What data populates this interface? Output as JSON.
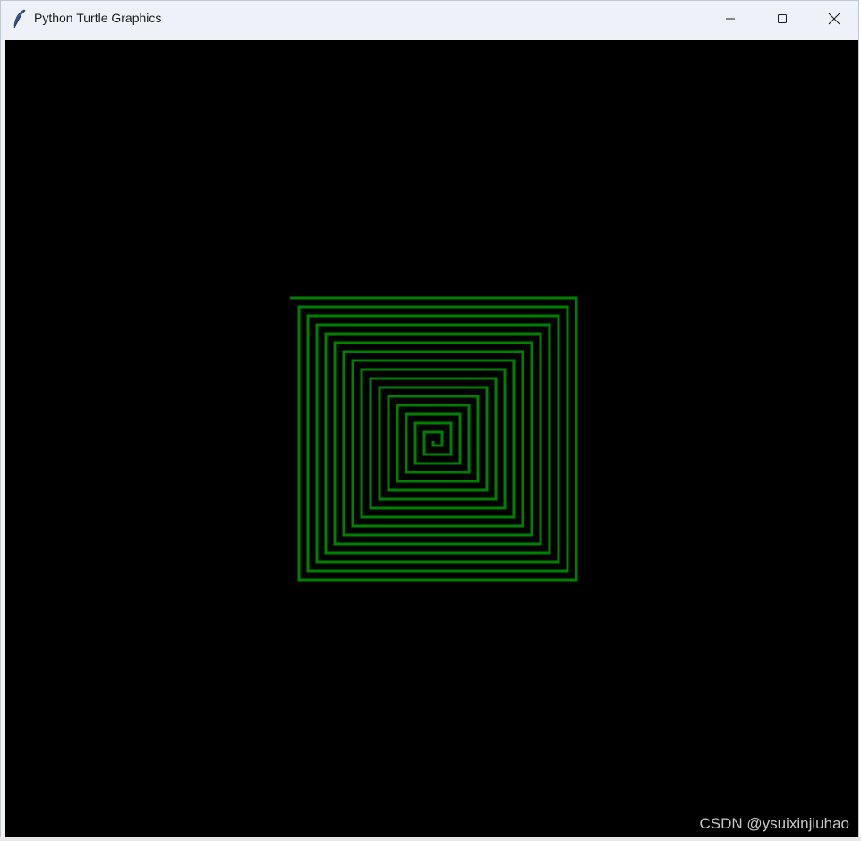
{
  "window": {
    "title": "Python Turtle Graphics"
  },
  "titlebar": {
    "icon": "feather-icon",
    "controls": [
      "minimize-icon",
      "maximize-icon",
      "close-icon"
    ]
  },
  "canvas": {
    "background": "#000000",
    "pen_color": "#008000",
    "spiral_loops": 16
  },
  "watermark": {
    "text": "CSDN @ysuixinjiuhao"
  }
}
